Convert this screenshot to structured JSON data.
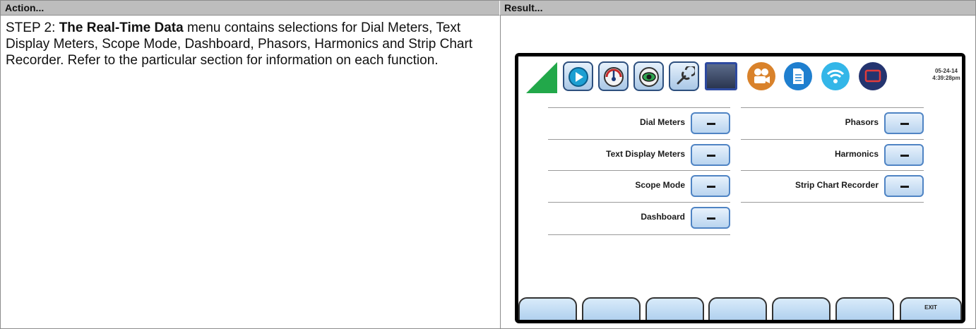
{
  "table": {
    "header_action": "Action...",
    "header_result": "Result...",
    "step_prefix": "STEP 2: ",
    "step_bold": "The Real-Time Data",
    "step_rest": " menu contains selections for Dial Meters, Text Display Meters, Scope Mode, Dashboard, Phasors, Harmonics and Strip Chart Recorder. Refer to the particular section for information on each function."
  },
  "device": {
    "date": "05-24-14",
    "time": "4:39:28pm",
    "accent_green": "#22a84a",
    "toolbar_icons": [
      "home-triangle-icon",
      "play-icon",
      "meter-gauge-icon",
      "eye-icon",
      "wrench-icon",
      "tablet-icon",
      "video-camera-icon",
      "document-icon",
      "wireless-icon",
      "screen-frame-icon"
    ],
    "menu_left": [
      {
        "label": "Dial Meters",
        "button": "—"
      },
      {
        "label": "Text Display Meters",
        "button": "—"
      },
      {
        "label": "Scope Mode",
        "button": "—"
      },
      {
        "label": "Dashboard",
        "button": "—"
      }
    ],
    "menu_right": [
      {
        "label": "Phasors",
        "button": "—"
      },
      {
        "label": "Harmonics",
        "button": "—"
      },
      {
        "label": "Strip Chart Recorder",
        "button": "—"
      }
    ],
    "softkeys": [
      "",
      "",
      "",
      "",
      "",
      "",
      "EXIT"
    ]
  }
}
